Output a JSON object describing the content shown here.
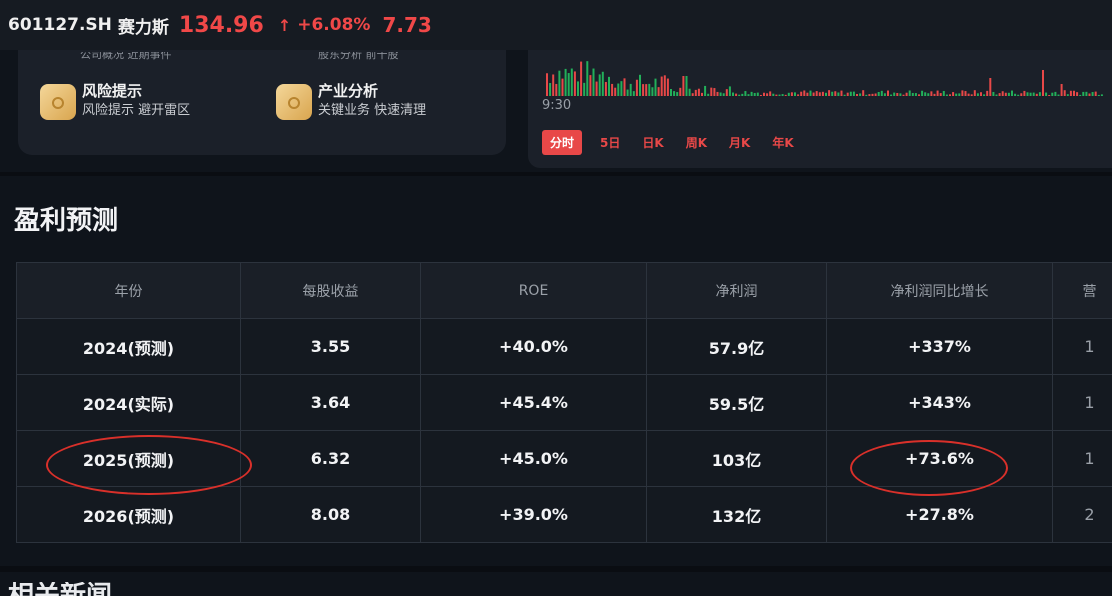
{
  "header": {
    "ticker": "601127.SH",
    "name": "赛力斯",
    "price": "134.96",
    "arrow": "↑",
    "change_pct": "+6.08%",
    "change": "7.73"
  },
  "features": {
    "clipped_left": "公司概况 近期事件",
    "clipped_right": "股东分析 前十股",
    "items": [
      {
        "title": "风险提示",
        "subtitle": "风险提示 避开雷区"
      },
      {
        "title": "产业分析",
        "subtitle": "关键业务 快速清理"
      }
    ]
  },
  "chart": {
    "time": "9:30",
    "tabs": [
      "分时",
      "5日",
      "日K",
      "周K",
      "月K",
      "年K"
    ],
    "active_tab": "分时",
    "colors": {
      "up": "#e84848",
      "down": "#22b05a"
    }
  },
  "section": {
    "title": "盈利预测",
    "bottom_title": "相关新闻"
  },
  "table": {
    "headers": [
      "年份",
      "每股收益",
      "ROE",
      "净利润",
      "净利润同比增长",
      "营"
    ],
    "rows": [
      {
        "year": "2024(预测)",
        "eps": "3.55",
        "roe": "+40.0%",
        "profit": "57.9亿",
        "growth": "+337%",
        "extra": "1"
      },
      {
        "year": "2024(实际)",
        "eps": "3.64",
        "roe": "+45.4%",
        "profit": "59.5亿",
        "growth": "+343%",
        "extra": "1"
      },
      {
        "year": "2025(预测)",
        "eps": "6.32",
        "roe": "+45.0%",
        "profit": "103亿",
        "growth": "+73.6%",
        "extra": "1"
      },
      {
        "year": "2026(预测)",
        "eps": "8.08",
        "roe": "+39.0%",
        "profit": "132亿",
        "growth": "+27.8%",
        "extra": "2"
      }
    ]
  }
}
